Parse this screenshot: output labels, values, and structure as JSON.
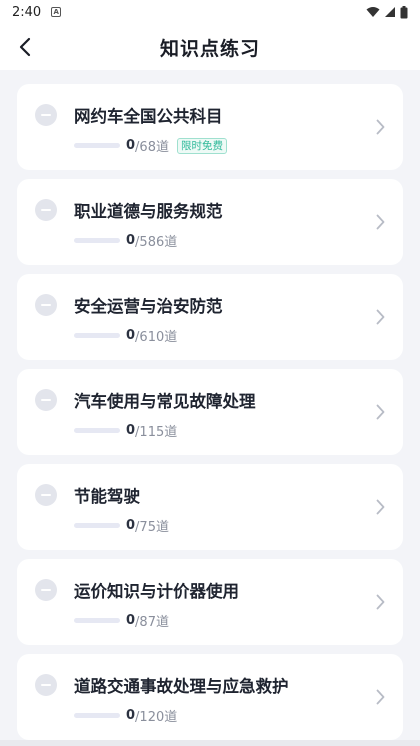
{
  "status_bar": {
    "time": "2:40"
  },
  "header": {
    "title": "知识点练习"
  },
  "items": [
    {
      "title": "网约车全国公共科目",
      "done": "0",
      "total": "/68道",
      "badge": "限时免费",
      "progress": 0
    },
    {
      "title": "职业道德与服务规范",
      "done": "0",
      "total": "/586道",
      "progress": 0
    },
    {
      "title": "安全运营与治安防范",
      "done": "0",
      "total": "/610道",
      "progress": 0
    },
    {
      "title": "汽车使用与常见故障处理",
      "done": "0",
      "total": "/115道",
      "progress": 0
    },
    {
      "title": "节能驾驶",
      "done": "0",
      "total": "/75道",
      "progress": 0
    },
    {
      "title": "运价知识与计价器使用",
      "done": "0",
      "total": "/87道",
      "progress": 0
    },
    {
      "title": "道路交通事故处理与应急救护",
      "done": "0",
      "total": "/120道",
      "progress": 0
    }
  ],
  "colors": {
    "accent": "#4a7bf7",
    "badge": "#2fb99a"
  }
}
